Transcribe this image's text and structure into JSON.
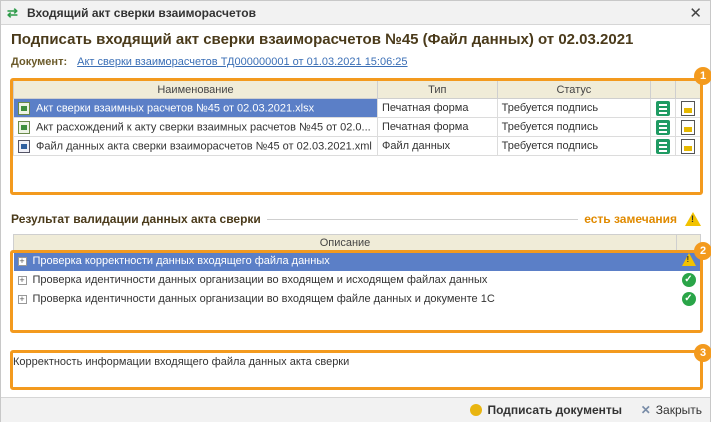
{
  "window": {
    "title": "Входящий акт сверки взаиморасчетов",
    "close_glyph": "✕"
  },
  "heading": "Подписать входящий акт сверки взаиморасчетов №45 (Файл данных) от 02.03.2021",
  "document": {
    "label": "Документ:",
    "link": "Акт сверки взаиморасчетов ТД000000001 от 01.03.2021 15:06:25"
  },
  "files_table": {
    "columns": [
      "Наименование",
      "Тип",
      "Статус"
    ],
    "rows": [
      {
        "name": "Акт сверки взаимных расчетов №45 от 02.03.2021.xlsx",
        "type": "Печатная форма",
        "status": "Требуется подпись",
        "icon": "excel-file-icon"
      },
      {
        "name": "Акт расхождений к акту сверки взаимных расчетов №45 от 02.0...",
        "type": "Печатная форма",
        "status": "Требуется подпись",
        "icon": "excel-file-icon"
      },
      {
        "name": "Файл данных акта сверки взаиморасчетов №45 от 02.03.2021.xml",
        "type": "Файл данных",
        "status": "Требуется подпись",
        "icon": "xml-file-icon"
      }
    ]
  },
  "validation": {
    "title": "Результат валидации данных акта сверки",
    "summary": "есть замечания",
    "column": "Описание",
    "rows": [
      {
        "text": "Проверка корректности данных входящего файла данных",
        "state": "warning"
      },
      {
        "text": "Проверка идентичности данных организации во входящем и исходящем файлах данных",
        "state": "ok"
      },
      {
        "text": "Проверка идентичности данных организации во входящем файле данных и документе 1С",
        "state": "ok"
      }
    ]
  },
  "description": "Корректность информации входящего файла данных акта сверки",
  "badges": [
    "1",
    "2",
    "3"
  ],
  "footer": {
    "sign_button": "Подписать документы",
    "close_button": "Закрыть"
  },
  "colors": {
    "accent_orange": "#f39a1e",
    "selection_blue": "#5b7fc7",
    "ok_green": "#2aa548",
    "warning_yellow": "#f2c200"
  }
}
